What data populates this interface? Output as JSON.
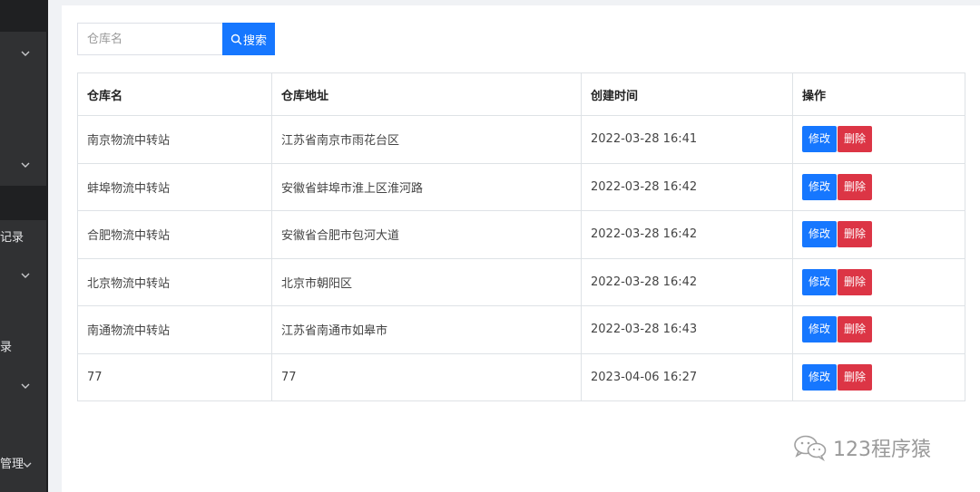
{
  "sidebar": {
    "items": [
      {
        "label": ""
      },
      {
        "label": ""
      },
      {
        "label": "记录"
      },
      {
        "label": ""
      },
      {
        "label": "录"
      },
      {
        "label": ""
      },
      {
        "label": "管理"
      }
    ]
  },
  "search": {
    "placeholder": "仓库名",
    "value": "",
    "button_label": "搜索",
    "button_icon": "search-icon"
  },
  "table": {
    "headers": [
      "仓库名",
      "仓库地址",
      "创建时间",
      "操作"
    ],
    "rows": [
      {
        "name": "南京物流中转站",
        "address": "江苏省南京市雨花台区",
        "created": "2022-03-28 16:41"
      },
      {
        "name": "蚌埠物流中转站",
        "address": "安徽省蚌埠市淮上区淮河路",
        "created": "2022-03-28 16:42"
      },
      {
        "name": "合肥物流中转站",
        "address": "安徽省合肥市包河大道",
        "created": "2022-03-28 16:42"
      },
      {
        "name": "北京物流中转站",
        "address": "北京市朝阳区",
        "created": "2022-03-28 16:42"
      },
      {
        "name": "南通物流中转站",
        "address": "江苏省南通市如皋市",
        "created": "2022-03-28 16:43"
      },
      {
        "name": "77",
        "address": "77",
        "created": "2023-04-06 16:27"
      }
    ],
    "edit_label": "修改",
    "delete_label": "删除"
  },
  "watermark": {
    "text": "123程序猿",
    "icon": "wechat-icon"
  },
  "colors": {
    "sidebar_bg": "#303133",
    "primary": "#1677ff",
    "danger": "#dc3545",
    "page_bg": "#f0f2f5",
    "border": "#dee2e6"
  }
}
